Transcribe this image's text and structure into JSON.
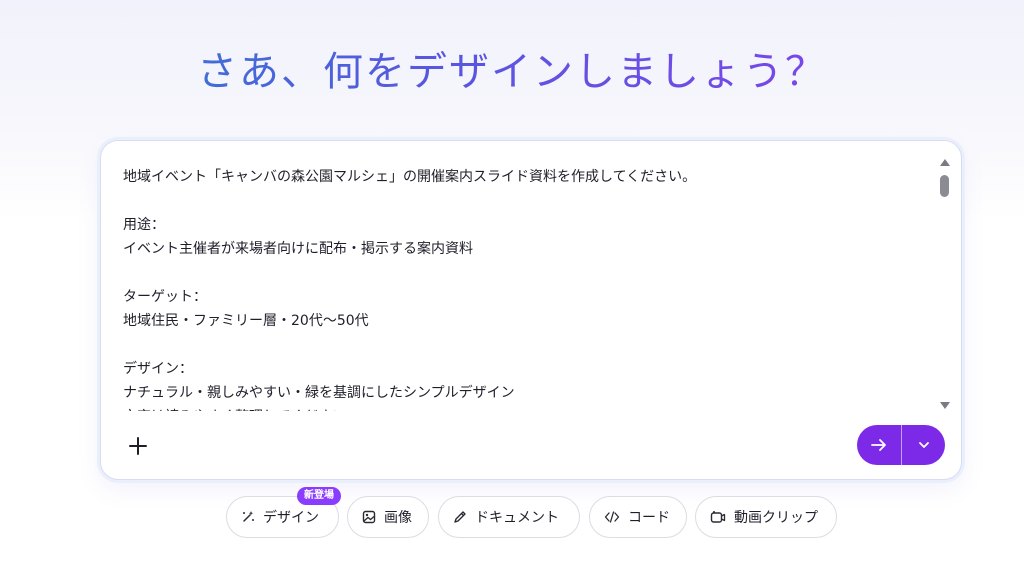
{
  "headline": "さあ、何をデザインしましょう？",
  "prompt": {
    "text": "地域イベント「キャンバの森公園マルシェ」の開催案内スライド資料を作成してください。\n\n用途：\nイベント主催者が来場者向けに配布・掲示する案内資料\n\nターゲット：\n地域住民・ファミリー層・20代〜50代\n\nデザイン：\nナチュラル・親しみやすい・緑を基調にしたシンプルデザイン\n文字は読みやすく整理してください"
  },
  "colors": {
    "accent": "#7d2ae8",
    "badge": "#8b3dff",
    "headline_gradient": [
      "#2f7fd0",
      "#8a3ff0"
    ]
  },
  "chips": [
    {
      "label": "デザイン",
      "icon": "sparkle-icon",
      "badge": "新登場"
    },
    {
      "label": "画像",
      "icon": "image-icon"
    },
    {
      "label": "ドキュメント",
      "icon": "pen-icon"
    },
    {
      "label": "コード",
      "icon": "code-icon"
    },
    {
      "label": "動画クリップ",
      "icon": "video-icon"
    }
  ]
}
